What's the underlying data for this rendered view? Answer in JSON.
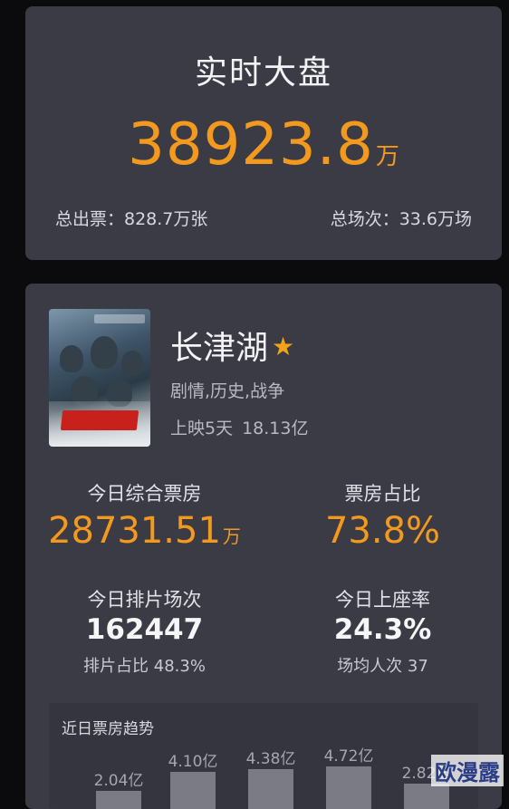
{
  "realtime": {
    "title": "实时大盘",
    "total_value": "38923.8",
    "total_unit": "万",
    "tickets": "总出票：828.7万张",
    "screenings": "总场次：33.6万场"
  },
  "movie": {
    "name": "长津湖",
    "genre": "剧情,历史,战争",
    "release_days": "上映5天",
    "cumulative": "18.13亿",
    "stats": {
      "today_box_label": "今日综合票房",
      "today_box_value": "28731.51",
      "today_box_unit": "万",
      "share_label": "票房占比",
      "share_value": "73.8%",
      "screenings_label": "今日排片场次",
      "screenings_value": "162447",
      "screenings_share": "排片占比 48.3%",
      "occupancy_label": "今日上座率",
      "occupancy_value": "24.3%",
      "avg_attendance": "场均人次 37"
    },
    "trend": {
      "title": "近日票房趋势",
      "values": [
        2.04,
        4.1,
        4.38,
        4.72,
        2.82
      ],
      "labels": [
        "2.04亿",
        "4.10亿",
        "4.38亿",
        "4.72亿",
        "2.82亿"
      ]
    }
  },
  "watermark": "欧漫露"
}
